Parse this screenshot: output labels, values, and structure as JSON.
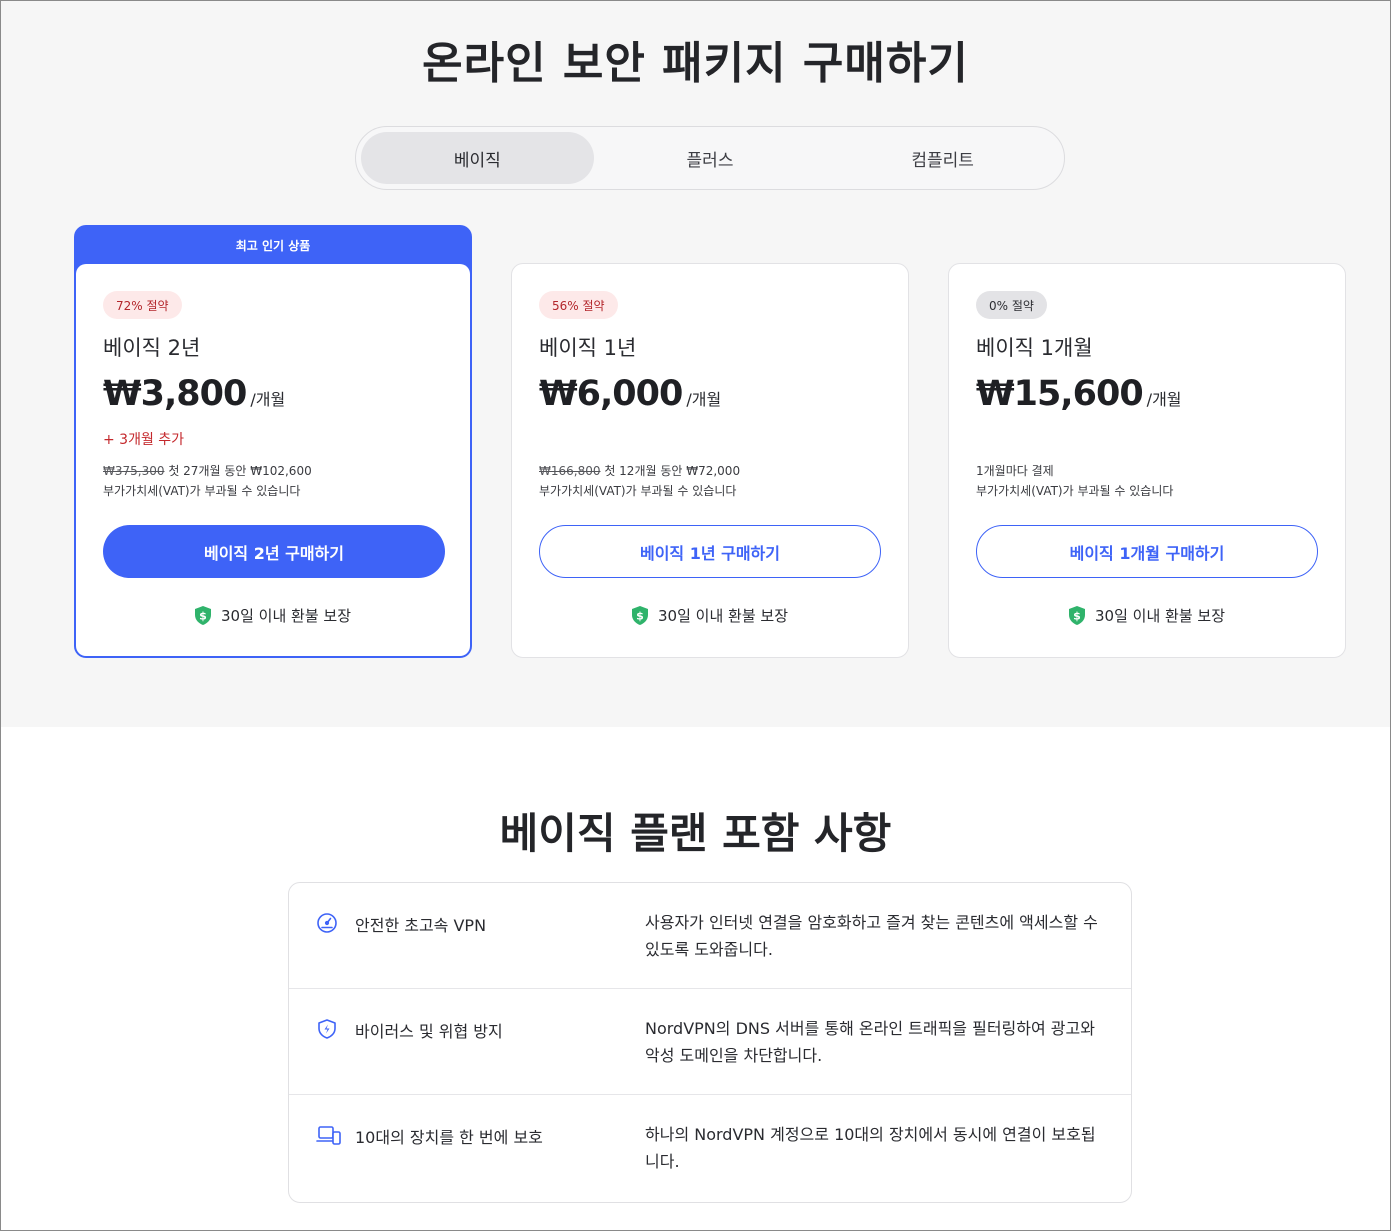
{
  "page": {
    "title": "온라인 보안 패키지 구매하기"
  },
  "tabs": [
    {
      "label": "베이직",
      "active": true
    },
    {
      "label": "플러스",
      "active": false
    },
    {
      "label": "컴플리트",
      "active": false
    }
  ],
  "cards": [
    {
      "banner": "최고 인기 상품",
      "badge": "72% 절약",
      "name": "베이직 2년",
      "price": "₩3,800",
      "per": "/개월",
      "bonus": "+ 3개월 추가",
      "original_price": "₩375,300",
      "detail_line1": " 첫 27개월 동안 ₩102,600",
      "detail_line2": "부가가치세(VAT)가 부과될 수 있습니다",
      "button": "베이직 2년 구매하기",
      "refund": "30일 이내 환불 보장"
    },
    {
      "badge": "56% 절약",
      "name": "베이직 1년",
      "price": "₩6,000",
      "per": "/개월",
      "original_price": "₩166,800",
      "detail_line1": " 첫 12개월 동안 ₩72,000",
      "detail_line2": "부가가치세(VAT)가 부과될 수 있습니다",
      "button": "베이직 1년 구매하기",
      "refund": "30일 이내 환불 보장"
    },
    {
      "badge": "0% 절약",
      "name": "베이직 1개월",
      "price": "₩15,600",
      "per": "/개월",
      "detail_line1": "1개월마다 결제",
      "detail_line2": "부가가치세(VAT)가 부과될 수 있습니다",
      "button": "베이직 1개월 구매하기",
      "refund": "30일 이내 환불 보장"
    }
  ],
  "features": {
    "title": "베이직 플랜 포함 사항",
    "items": [
      {
        "icon": "speedometer-icon",
        "name": "안전한 초고속 VPN",
        "desc": "사용자가 인터넷 연결을 암호화하고 즐겨 찾는 콘텐츠에 액세스할 수 있도록 도와줍니다."
      },
      {
        "icon": "shield-bolt-icon",
        "name": "바이러스 및 위협 방지",
        "desc": "NordVPN의 DNS 서버를 통해 온라인 트래픽을 필터링하여 광고와 악성 도메인을 차단합니다."
      },
      {
        "icon": "devices-icon",
        "name": "10대의 장치를 한 번에 보호",
        "desc": "하나의 NordVPN 계정으로 10대의 장치에서 동시에 연결이 보호됩니다."
      }
    ]
  },
  "colors": {
    "accent": "#3e63f7",
    "save_red": "#c4282c",
    "refund_green": "#2fb36b"
  }
}
